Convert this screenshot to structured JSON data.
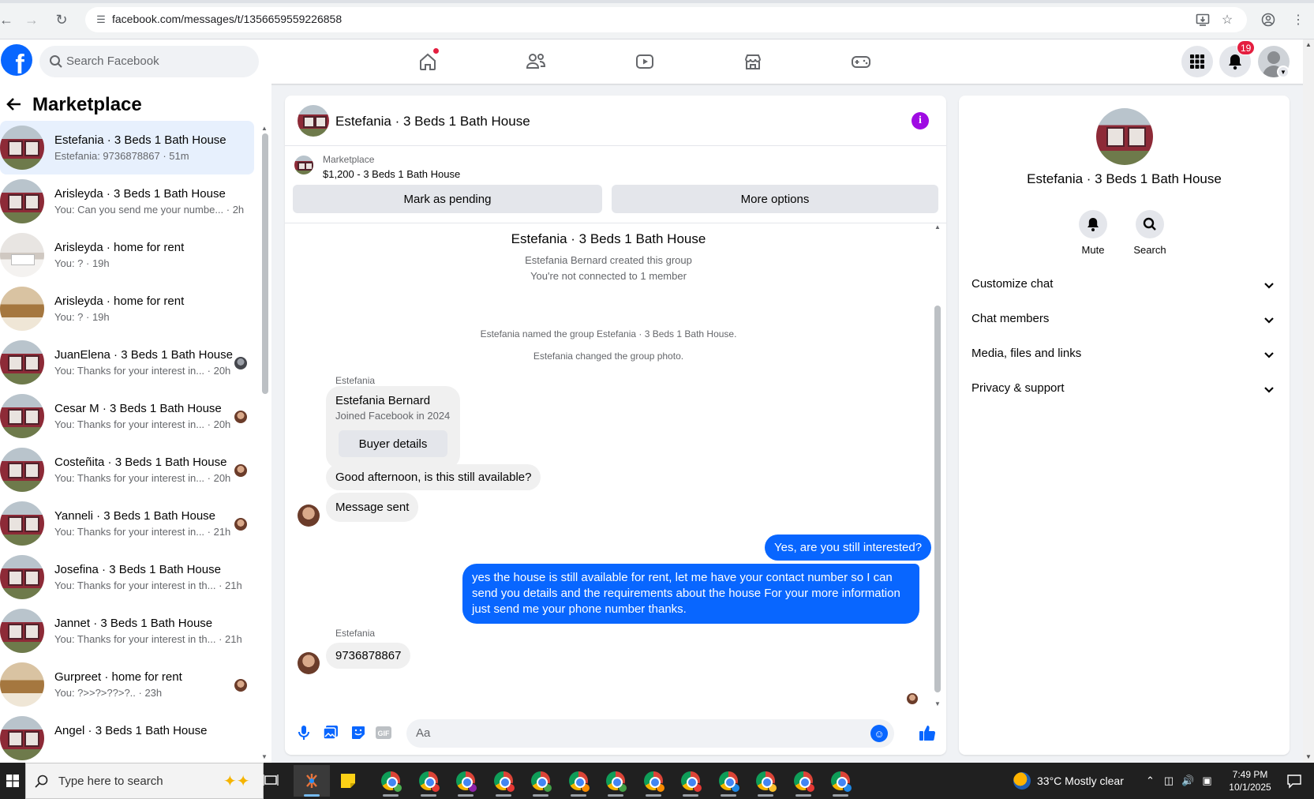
{
  "browser": {
    "url": "facebook.com/messages/t/1356659559226858"
  },
  "header": {
    "search_placeholder": "Search Facebook",
    "notification_count": "19",
    "accent_color": "#0866ff"
  },
  "sidebar": {
    "title": "Marketplace",
    "conversations": [
      {
        "name": "Estefania · 3 Beds 1 Bath House",
        "preview": "Estefania: 9736878867 · 51m",
        "thumb": "house",
        "active": true,
        "mini": ""
      },
      {
        "name": "Arisleyda · 3 Beds 1 Bath House",
        "preview": "You: Can you send me your numbe... · 2h",
        "thumb": "house",
        "mini": ""
      },
      {
        "name": "Arisleyda · home for rent",
        "preview": "You: ? · 19h",
        "thumb": "room",
        "mini": ""
      },
      {
        "name": "Arisleyda · home for rent",
        "preview": "You: ? · 19h",
        "thumb": "room2",
        "mini": ""
      },
      {
        "name": "JuanElena · 3 Beds 1 Bath House",
        "preview": "You: Thanks for your interest in... · 20h",
        "thumb": "house",
        "mini": "face2"
      },
      {
        "name": "Cesar M · 3 Beds 1 Bath House",
        "preview": "You: Thanks for your interest in... · 20h",
        "thumb": "house",
        "mini": "face"
      },
      {
        "name": "Costeñita · 3 Beds 1 Bath House",
        "preview": "You: Thanks for your interest in... · 20h",
        "thumb": "house",
        "mini": "face"
      },
      {
        "name": "Yanneli · 3 Beds 1 Bath House",
        "preview": "You: Thanks for your interest in... · 21h",
        "thumb": "house",
        "mini": "face"
      },
      {
        "name": "Josefina · 3 Beds 1 Bath House",
        "preview": "You: Thanks for your interest in th... · 21h",
        "thumb": "house",
        "mini": ""
      },
      {
        "name": "Jannet · 3 Beds 1 Bath House",
        "preview": "You: Thanks for your interest in th... · 21h",
        "thumb": "house",
        "mini": ""
      },
      {
        "name": "Gurpreet · home for rent",
        "preview": "You: ?>>?>??>?.. · 23h",
        "thumb": "room2",
        "mini": "face"
      },
      {
        "name": "Angel · 3 Beds 1 Bath House",
        "preview": "",
        "thumb": "house",
        "mini": ""
      }
    ]
  },
  "chat": {
    "title": "Estefania · 3 Beds 1 Bath House",
    "listing": {
      "label": "Marketplace",
      "price_title": "$1,200 - 3 Beds 1 Bath House",
      "btn_pending": "Mark as pending",
      "btn_more": "More options"
    },
    "thread": {
      "group_title": "Estefania · 3 Beds 1 Bath House",
      "created": "Estefania Bernard created this group",
      "not_connected": "You're not connected to 1 member",
      "named": "Estefania named the group Estefania · 3 Beds 1 Bath House.",
      "photo_changed": "Estefania changed the group photo.",
      "sender1": "Estefania",
      "card_name": "Estefania Bernard",
      "card_joined": "Joined Facebook in 2024",
      "card_btn": "Buyer details",
      "msg_in_1": "Good afternoon, is this still available?",
      "msg_in_2": "Message sent",
      "msg_out_1": "Yes, are you still interested?",
      "msg_out_2": "yes the house is still available for rent, let me have your contact number so I can send you details and the requirements about the house For  your  more  information  just  send  me   your  phone  number thanks.",
      "sender2": "Estefania",
      "msg_in_3": "9736878867"
    },
    "composer_placeholder": "Aa"
  },
  "details": {
    "name": "Estefania · 3 Beds 1 Bath House",
    "mute_label": "Mute",
    "search_label": "Search",
    "sections": [
      "Customize chat",
      "Chat members",
      "Media, files and links",
      "Privacy & support"
    ]
  },
  "taskbar": {
    "search_placeholder": "Type here to search",
    "weather": "33°C  Mostly clear",
    "time": "7:49 PM",
    "date": "10/1/2025"
  }
}
